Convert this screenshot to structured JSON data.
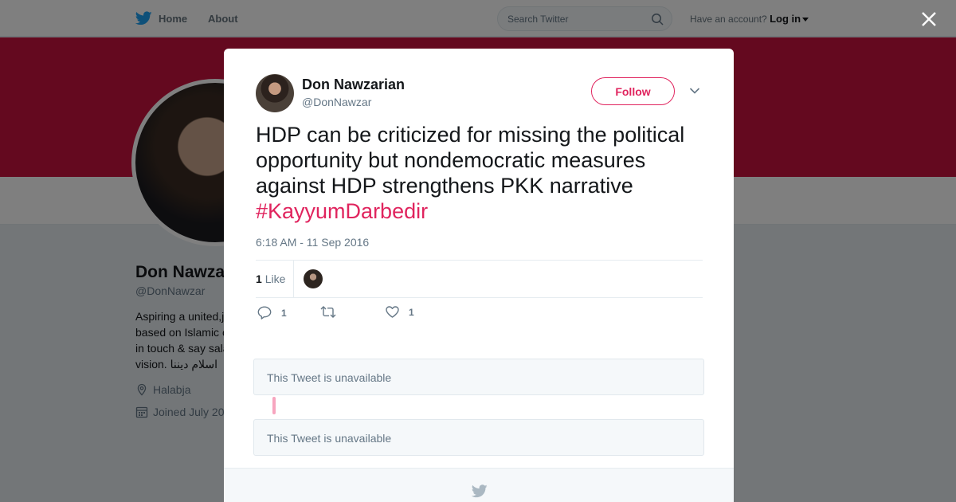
{
  "topbar": {
    "home_label": "Home",
    "about_label": "About",
    "search_placeholder": "Search Twitter",
    "account_prompt": "Have an account?",
    "login_label": "Log in"
  },
  "profile": {
    "name": "Don Nawza",
    "handle": "@DonNawzar",
    "bio": "Aspiring a united,j\nbased on Islamic c\nin touch & say sala\nvision. اسلام ديننا",
    "location": "Halabja",
    "joined": "Joined July 20"
  },
  "tweet": {
    "fullname": "Don Nawzarian",
    "username": "@DonNawzar",
    "follow_label": "Follow",
    "text": "HDP can be criticized for missing the political opportunity but nondemocratic measures against HDP strengthens PKK narrative ",
    "hashtag": "#KayyumDarbedir",
    "timestamp": "6:18 AM - 11 Sep 2016",
    "like_count": "1",
    "like_label": "Like",
    "reply_count": "1",
    "heart_count": "1"
  },
  "replies": [
    {
      "text": "This Tweet is unavailable"
    },
    {
      "text": "This Tweet is unavailable"
    }
  ],
  "colors": {
    "brand_blue": "#1da1f2",
    "accent_pink": "#e0245e",
    "banner": "#c9123f"
  },
  "icons": [
    "twitter-bird-icon",
    "search-icon",
    "close-icon",
    "chevron-down-icon",
    "reply-icon",
    "retweet-icon",
    "heart-icon",
    "location-icon",
    "calendar-icon"
  ]
}
